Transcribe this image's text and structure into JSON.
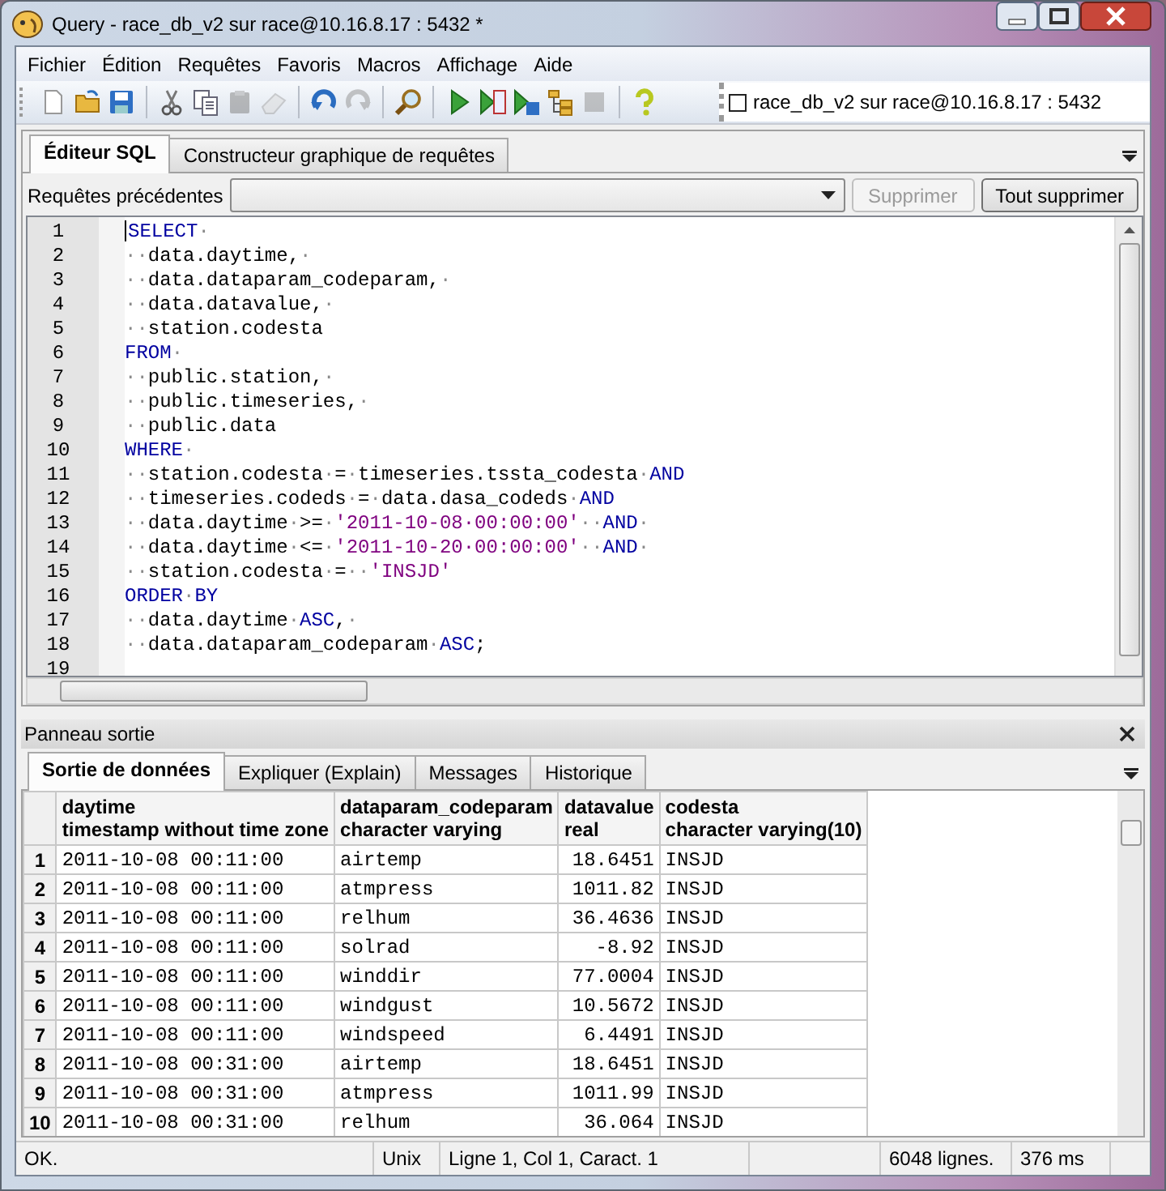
{
  "window": {
    "title": "Query - race_db_v2 sur race@10.16.8.17 : 5432 *"
  },
  "menu": [
    {
      "label": "Fichier"
    },
    {
      "label": "Édition"
    },
    {
      "label": "Requêtes"
    },
    {
      "label": "Favoris"
    },
    {
      "label": "Macros"
    },
    {
      "label": "Affichage"
    },
    {
      "label": "Aide"
    }
  ],
  "toolbar": {
    "buttons": [
      {
        "kind": "new",
        "disabled": false
      },
      {
        "kind": "open",
        "disabled": false
      },
      {
        "kind": "save",
        "disabled": false
      },
      {
        "kind": "sep"
      },
      {
        "kind": "cut",
        "disabled": false
      },
      {
        "kind": "copy",
        "disabled": false
      },
      {
        "kind": "paste",
        "disabled": true
      },
      {
        "kind": "clear",
        "disabled": true
      },
      {
        "kind": "sep"
      },
      {
        "kind": "undo",
        "disabled": false
      },
      {
        "kind": "redo",
        "disabled": true
      },
      {
        "kind": "sep"
      },
      {
        "kind": "find",
        "disabled": false
      },
      {
        "kind": "sep"
      },
      {
        "kind": "run",
        "disabled": false
      },
      {
        "kind": "run_pgs",
        "disabled": false
      },
      {
        "kind": "run_file",
        "disabled": false
      },
      {
        "kind": "explain",
        "disabled": false
      },
      {
        "kind": "stop",
        "disabled": true
      },
      {
        "kind": "sep"
      },
      {
        "kind": "help",
        "disabled": false
      }
    ],
    "connection": {
      "checked": false,
      "label": "race_db_v2 sur race@10.16.8.17 : 5432"
    }
  },
  "editor_tabs": [
    {
      "label": "Éditeur SQL",
      "selected": true
    },
    {
      "label": "Constructeur graphique de requêtes",
      "selected": false
    }
  ],
  "previous_queries": {
    "label": "Requêtes précédentes",
    "buttons": [
      {
        "label": "Supprimer",
        "disabled": true
      },
      {
        "label": "Tout supprimer",
        "disabled": false
      }
    ]
  },
  "editor": {
    "lines": [
      {
        "number": "1",
        "tokens": [
          {
            "kind": "keyword",
            "text": "SELECT"
          },
          {
            "kind": "space",
            "text": "·"
          }
        ]
      },
      {
        "number": "2",
        "tokens": [
          {
            "kind": "space",
            "text": "··"
          },
          {
            "kind": "plain",
            "text": "data.daytime,"
          },
          {
            "kind": "space",
            "text": "·"
          }
        ]
      },
      {
        "number": "3",
        "tokens": [
          {
            "kind": "space",
            "text": "··"
          },
          {
            "kind": "plain",
            "text": "data.dataparam_codeparam,"
          },
          {
            "kind": "space",
            "text": "·"
          }
        ]
      },
      {
        "number": "4",
        "tokens": [
          {
            "kind": "space",
            "text": "··"
          },
          {
            "kind": "plain",
            "text": "data.datavalue,"
          },
          {
            "kind": "space",
            "text": "·"
          }
        ]
      },
      {
        "number": "5",
        "tokens": [
          {
            "kind": "space",
            "text": "··"
          },
          {
            "kind": "plain",
            "text": "station.codesta"
          }
        ]
      },
      {
        "number": "6",
        "tokens": [
          {
            "kind": "keyword",
            "text": "FROM"
          },
          {
            "kind": "space",
            "text": "·"
          }
        ]
      },
      {
        "number": "7",
        "tokens": [
          {
            "kind": "space",
            "text": "··"
          },
          {
            "kind": "plain",
            "text": "public.station,"
          },
          {
            "kind": "space",
            "text": "·"
          }
        ]
      },
      {
        "number": "8",
        "tokens": [
          {
            "kind": "space",
            "text": "··"
          },
          {
            "kind": "plain",
            "text": "public.timeseries,"
          },
          {
            "kind": "space",
            "text": "·"
          }
        ]
      },
      {
        "number": "9",
        "tokens": [
          {
            "kind": "space",
            "text": "··"
          },
          {
            "kind": "plain",
            "text": "public.data"
          }
        ]
      },
      {
        "number": "10",
        "tokens": [
          {
            "kind": "keyword",
            "text": "WHERE"
          },
          {
            "kind": "space",
            "text": "·"
          }
        ]
      },
      {
        "number": "11",
        "tokens": [
          {
            "kind": "space",
            "text": "··"
          },
          {
            "kind": "plain",
            "text": "station.codesta"
          },
          {
            "kind": "space",
            "text": "·"
          },
          {
            "kind": "plain",
            "text": "="
          },
          {
            "kind": "space",
            "text": "·"
          },
          {
            "kind": "plain",
            "text": "timeseries.tssta_codesta"
          },
          {
            "kind": "space",
            "text": "·"
          },
          {
            "kind": "keyword",
            "text": "AND"
          }
        ]
      },
      {
        "number": "12",
        "tokens": [
          {
            "kind": "space",
            "text": "··"
          },
          {
            "kind": "plain",
            "text": "timeseries.codeds"
          },
          {
            "kind": "space",
            "text": "·"
          },
          {
            "kind": "plain",
            "text": "="
          },
          {
            "kind": "space",
            "text": "·"
          },
          {
            "kind": "plain",
            "text": "data.dasa_codeds"
          },
          {
            "kind": "space",
            "text": "·"
          },
          {
            "kind": "keyword",
            "text": "AND"
          }
        ]
      },
      {
        "number": "13",
        "tokens": [
          {
            "kind": "space",
            "text": "··"
          },
          {
            "kind": "plain",
            "text": "data.daytime"
          },
          {
            "kind": "space",
            "text": "·"
          },
          {
            "kind": "plain",
            "text": ">="
          },
          {
            "kind": "space",
            "text": "·"
          },
          {
            "kind": "string",
            "text": "'2011-10-08·00:00:00'"
          },
          {
            "kind": "space",
            "text": "··"
          },
          {
            "kind": "keyword",
            "text": "AND"
          },
          {
            "kind": "space",
            "text": "·"
          }
        ]
      },
      {
        "number": "14",
        "tokens": [
          {
            "kind": "space",
            "text": "··"
          },
          {
            "kind": "plain",
            "text": "data.daytime"
          },
          {
            "kind": "space",
            "text": "·"
          },
          {
            "kind": "plain",
            "text": "<="
          },
          {
            "kind": "space",
            "text": "·"
          },
          {
            "kind": "string",
            "text": "'2011-10-20·00:00:00'"
          },
          {
            "kind": "space",
            "text": "··"
          },
          {
            "kind": "keyword",
            "text": "AND"
          },
          {
            "kind": "space",
            "text": "·"
          }
        ]
      },
      {
        "number": "15",
        "tokens": [
          {
            "kind": "space",
            "text": "··"
          },
          {
            "kind": "plain",
            "text": "station.codesta"
          },
          {
            "kind": "space",
            "text": "·"
          },
          {
            "kind": "plain",
            "text": "="
          },
          {
            "kind": "space",
            "text": "··"
          },
          {
            "kind": "string",
            "text": "'INSJD'"
          }
        ]
      },
      {
        "number": "16",
        "tokens": [
          {
            "kind": "keyword",
            "text": "ORDER"
          },
          {
            "kind": "space",
            "text": "·"
          },
          {
            "kind": "keyword",
            "text": "BY"
          }
        ]
      },
      {
        "number": "17",
        "tokens": [
          {
            "kind": "space",
            "text": "··"
          },
          {
            "kind": "plain",
            "text": "data.daytime"
          },
          {
            "kind": "space",
            "text": "·"
          },
          {
            "kind": "keyword",
            "text": "ASC"
          },
          {
            "kind": "plain",
            "text": ","
          },
          {
            "kind": "space",
            "text": "·"
          }
        ]
      },
      {
        "number": "18",
        "tokens": [
          {
            "kind": "space",
            "text": "··"
          },
          {
            "kind": "plain",
            "text": "data.dataparam_codeparam"
          },
          {
            "kind": "space",
            "text": "·"
          },
          {
            "kind": "keyword",
            "text": "ASC"
          },
          {
            "kind": "plain",
            "text": ";"
          }
        ]
      },
      {
        "number": "19"
      }
    ]
  },
  "output_panel": {
    "title": "Panneau sortie",
    "tabs": [
      {
        "label": "Sortie de données",
        "selected": true
      },
      {
        "label": "Expliquer (Explain)",
        "selected": false
      },
      {
        "label": "Messages",
        "selected": false
      },
      {
        "label": "Historique",
        "selected": false
      }
    ],
    "table": {
      "columns": [
        {
          "name": "daytime",
          "type": "timestamp without time zone",
          "kind": "text"
        },
        {
          "name": "dataparam_codeparam",
          "type": "character varying",
          "kind": "text"
        },
        {
          "name": "datavalue",
          "type": "real",
          "kind": "numeric"
        },
        {
          "name": "codesta",
          "type": "character varying(10)",
          "kind": "text"
        }
      ],
      "rows": [
        {
          "number": "1",
          "cells": [
            "2011-10-08 00:11:00",
            "airtemp",
            "18.6451",
            "INSJD"
          ]
        },
        {
          "number": "2",
          "cells": [
            "2011-10-08 00:11:00",
            "atmpress",
            "1011.82",
            "INSJD"
          ]
        },
        {
          "number": "3",
          "cells": [
            "2011-10-08 00:11:00",
            "relhum",
            "36.4636",
            "INSJD"
          ]
        },
        {
          "number": "4",
          "cells": [
            "2011-10-08 00:11:00",
            "solrad",
            "-8.92",
            "INSJD"
          ]
        },
        {
          "number": "5",
          "cells": [
            "2011-10-08 00:11:00",
            "winddir",
            "77.0004",
            "INSJD"
          ]
        },
        {
          "number": "6",
          "cells": [
            "2011-10-08 00:11:00",
            "windgust",
            "10.5672",
            "INSJD"
          ]
        },
        {
          "number": "7",
          "cells": [
            "2011-10-08 00:11:00",
            "windspeed",
            "6.4491",
            "INSJD"
          ]
        },
        {
          "number": "8",
          "cells": [
            "2011-10-08 00:31:00",
            "airtemp",
            "18.6451",
            "INSJD"
          ]
        },
        {
          "number": "9",
          "cells": [
            "2011-10-08 00:31:00",
            "atmpress",
            "1011.99",
            "INSJD"
          ]
        },
        {
          "number": "10",
          "cells": [
            "2011-10-08 00:31:00",
            "relhum",
            "36.064",
            "INSJD"
          ]
        }
      ]
    }
  },
  "status_bar": [
    {
      "text": "OK."
    },
    {
      "text": "Unix"
    },
    {
      "text": "Ligne 1, Col 1, Caract. 1"
    },
    {
      "text": "6048 lignes."
    },
    {
      "text": "376 ms"
    }
  ]
}
